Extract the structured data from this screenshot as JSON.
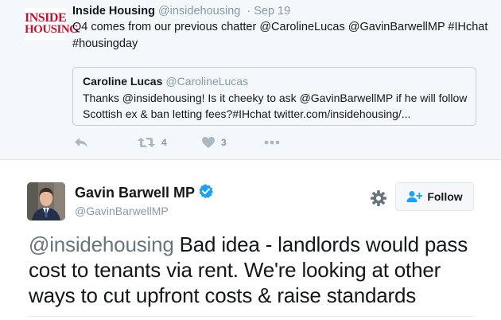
{
  "parent_tweet": {
    "author_name": "Inside Housing",
    "author_handle": "@insidehousing",
    "date": "· Sep 19",
    "logo": {
      "line1": "INSIDE",
      "line2": "HOUSING"
    },
    "text": "Q4 comes from our previous chatter @CarolineLucas @GavinBarwellMP #IHchat #housingday",
    "quoted": {
      "author_name": "Caroline Lucas",
      "author_handle": "@CarolineLucas",
      "text": "Thanks @insidehousing! Is it cheeky to ask @GavinBarwellMP if he will follow Scottish ex & ban letting fees?#IHchat  twitter.com/insidehousing/..."
    },
    "actions": {
      "reply_icon": "reply-icon",
      "retweet_icon": "retweet-icon",
      "retweet_count": "4",
      "like_icon": "heart-icon",
      "like_count": "3",
      "more_icon": "more-dots-icon"
    }
  },
  "main_tweet": {
    "author_name": "Gavin Barwell MP",
    "author_handle": "@GavinBarwellMP",
    "verified": true,
    "follow_label": "Follow",
    "mention": "@insidehousing",
    "text": " Bad idea - landlords would pass cost to tenants via rent. We're looking at other ways to cut upfront costs & raise standards"
  },
  "colors": {
    "brand_red": "#c8102e",
    "twitter_blue": "#1da1f2",
    "muted": "#8899a6",
    "parent_bg": "#f5f8fa"
  }
}
